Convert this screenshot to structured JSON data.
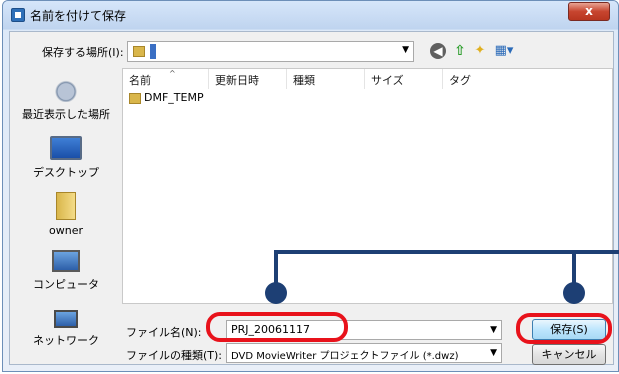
{
  "window": {
    "title": "名前を付けて保存",
    "close_label": "x"
  },
  "location": {
    "label": "保存する場所(I):"
  },
  "places": [
    {
      "label": "最近表示した場所",
      "icon": "recent-places-icon"
    },
    {
      "label": "デスクトップ",
      "icon": "desktop-icon"
    },
    {
      "label": "owner",
      "icon": "user-folder-icon"
    },
    {
      "label": "コンピュータ",
      "icon": "computer-icon"
    },
    {
      "label": "ネットワーク",
      "icon": "network-icon"
    }
  ],
  "file_list": {
    "columns": [
      "名前",
      "更新日時",
      "種類",
      "サイズ",
      "タグ"
    ],
    "items": [
      {
        "name": "DMF_TEMP",
        "type": "folder"
      }
    ]
  },
  "form": {
    "filename_label": "ファイル名(N):",
    "filename_value": "PRJ_20061117",
    "filetype_label": "ファイルの種類(T):",
    "filetype_value": "DVD MovieWriter プロジェクトファイル (*.dwz)"
  },
  "buttons": {
    "save_label": "保存(S)",
    "cancel_label": "キャンセル"
  },
  "colors": {
    "highlight": "#e8121b",
    "callout": "#1d3f74"
  }
}
